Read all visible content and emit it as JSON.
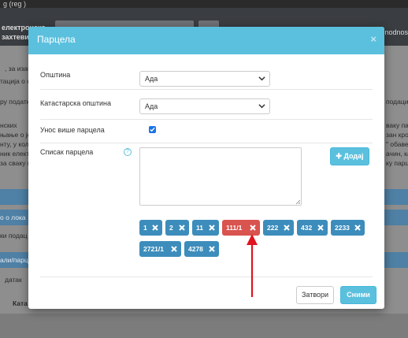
{
  "background": {
    "top_strip": "g                              (reg  )          ",
    "header_left": [
      "електронско",
      "захтеви"
    ],
    "header_right": "nodnos",
    "lines": [
      ", за изаб",
      "тација о ката",
      "ру податке",
      "нских",
      "њање о је",
      "нту, у кол",
      "ник електр",
      "за сваку н"
    ],
    "right_lines": [
      "подаци",
      "ваку пар",
      "зан крон",
      "\" обаве",
      "ачин, ката",
      "ку парц"
    ],
    "bars": [
      "",
      "о о лока"
    ],
    "lines2": [
      "ки подац",
      "али/парце",
      "датак",
      "Ката"
    ]
  },
  "modal": {
    "title": "Парцела",
    "close_symbol": "×",
    "opstina_label": "Општина",
    "opstina_value": "Ада",
    "kat_opstina_label": "Катастарска општина",
    "kat_opstina_value": "Ада",
    "multi_label": "Унос више парцела",
    "multi_checked": true,
    "list_label": "Списак парцела",
    "help_symbol": "?",
    "textarea_value": "",
    "add_button": "Додај",
    "add_icon": "plus-icon",
    "tags": [
      {
        "label": "1",
        "color": "#3c8dbc"
      },
      {
        "label": "2",
        "color": "#3c8dbc"
      },
      {
        "label": "11",
        "color": "#3c8dbc"
      },
      {
        "label": "111/1",
        "color": "#d9534f"
      },
      {
        "label": "222",
        "color": "#3c8dbc"
      },
      {
        "label": "432",
        "color": "#3c8dbc"
      },
      {
        "label": "2233",
        "color": "#3c8dbc"
      },
      {
        "label": "2721/1",
        "color": "#3c8dbc"
      },
      {
        "label": "4278",
        "color": "#3c8dbc"
      }
    ],
    "close_button": "Затвори",
    "save_button": "Сними"
  },
  "colors": {
    "header": "#5bc0de",
    "tag_blue": "#3c8dbc",
    "tag_red": "#d9534f",
    "arrow": "#e0141e"
  }
}
